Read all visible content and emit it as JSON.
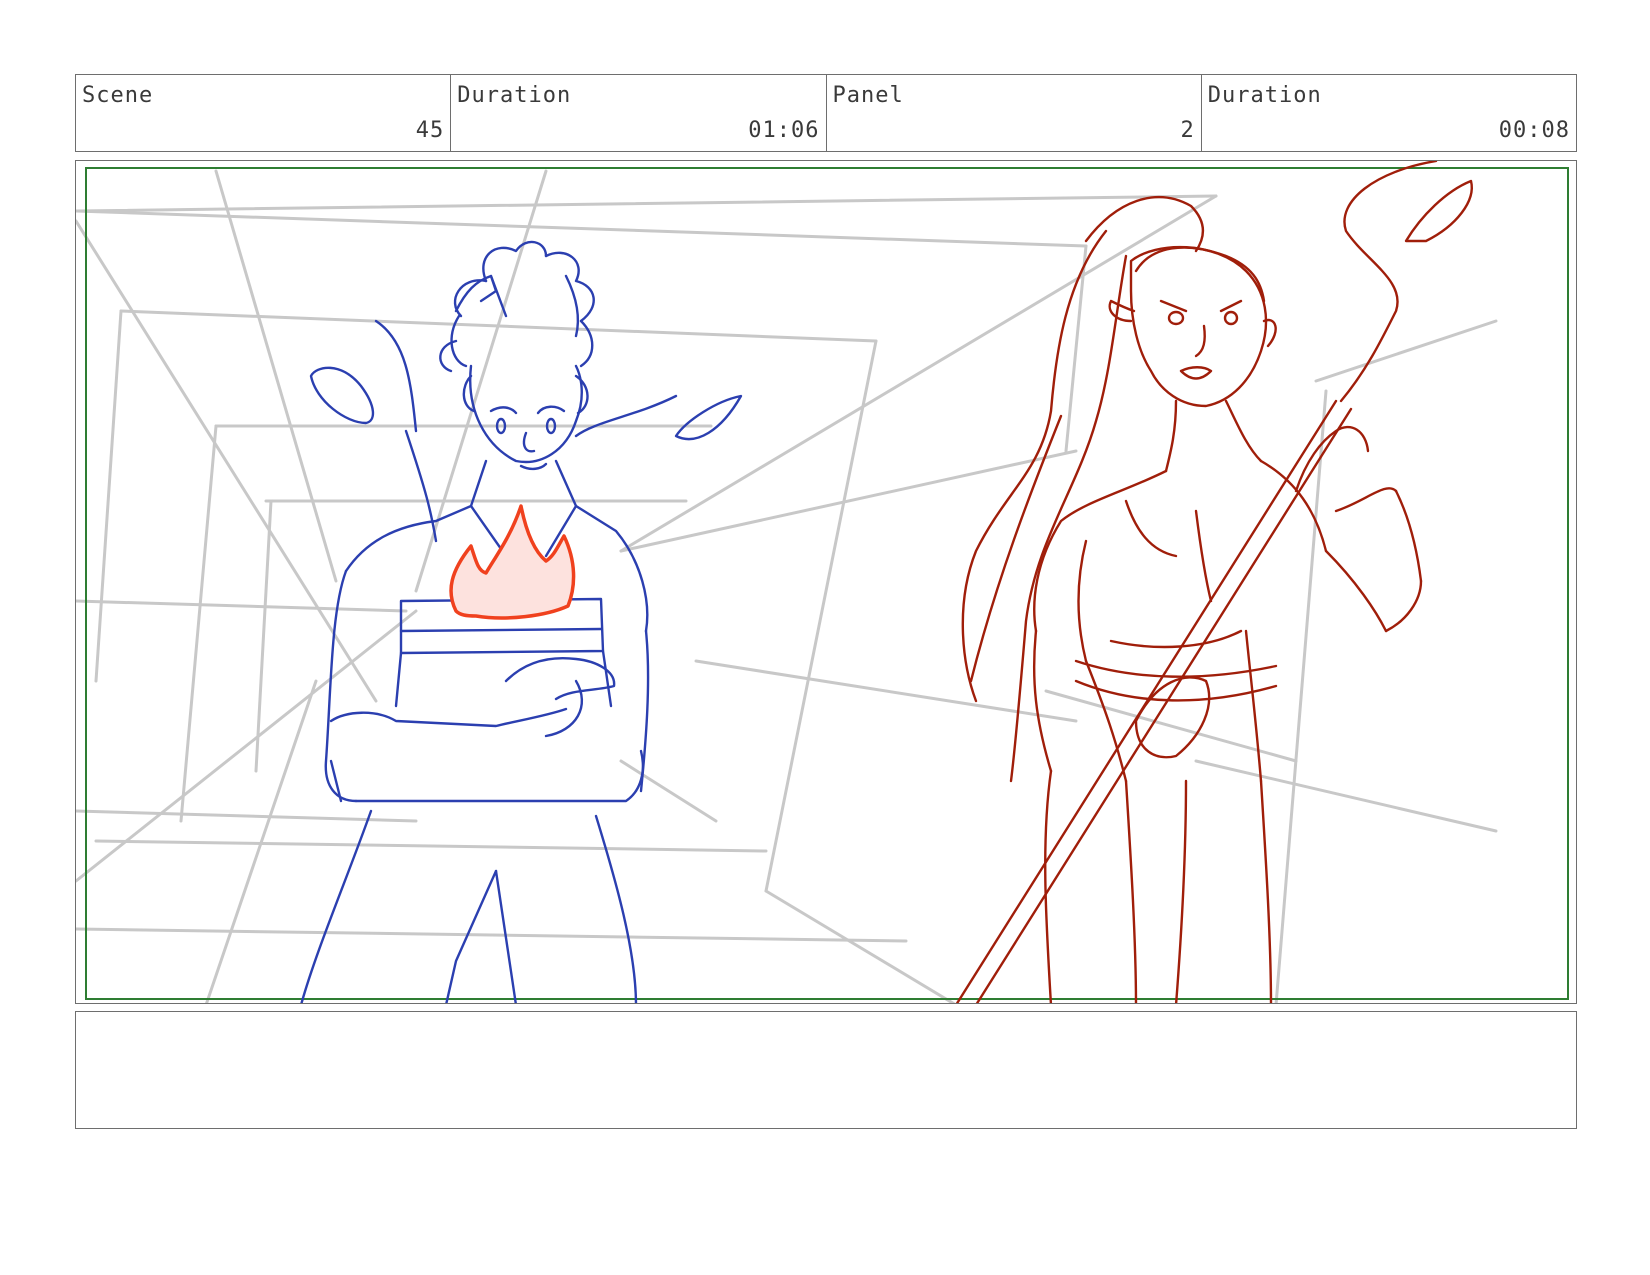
{
  "header": {
    "scene_label": "Scene",
    "scene_value": "45",
    "scene_duration_label": "Duration",
    "scene_duration_value": "01:06",
    "panel_label": "Panel",
    "panel_value": "2",
    "panel_duration_label": "Duration",
    "panel_duration_value": "00:08"
  },
  "drawing": {
    "background_color": "#c8c8c8",
    "safe_frame_color": "#2e7d32",
    "left_character_color": "#2b3fb0",
    "right_character_color": "#a01e0a",
    "fire_color": "#f0411e",
    "fire_fill": "#fde2de"
  },
  "notes": {
    "text": ""
  }
}
